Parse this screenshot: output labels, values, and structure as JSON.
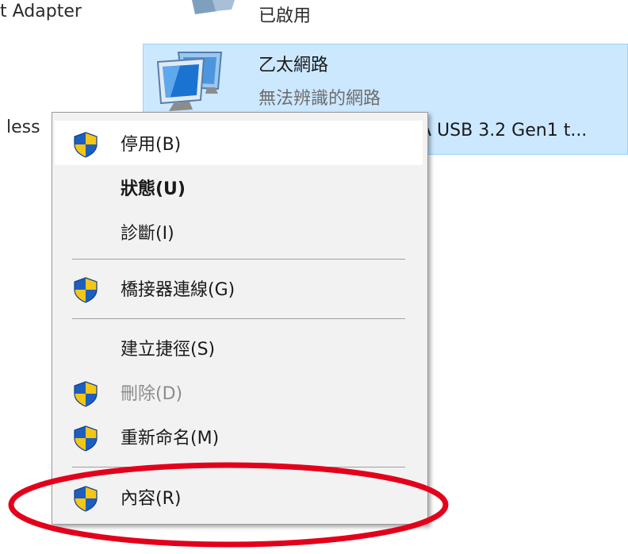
{
  "background": {
    "adapter_partial": "t Adapter",
    "disabled_status": "已啟用",
    "wireless_partial": "less"
  },
  "ethernet": {
    "name": "乙太網路",
    "status": "無法辨識的網路",
    "device": "A USB 3.2 Gen1 t..."
  },
  "context_menu": {
    "items": [
      {
        "label": "停用(B)",
        "icon": "uac-shield-icon"
      },
      {
        "label": "狀態(U)",
        "icon": ""
      },
      {
        "label": "診斷(I)",
        "icon": ""
      },
      {
        "label": "橋接器連線(G)",
        "icon": "uac-shield-icon"
      },
      {
        "label": "建立捷徑(S)",
        "icon": ""
      },
      {
        "label": "刪除(D)",
        "icon": "uac-shield-icon"
      },
      {
        "label": "重新命名(M)",
        "icon": "uac-shield-icon"
      },
      {
        "label": "內容(R)",
        "icon": "uac-shield-icon"
      }
    ]
  },
  "colors": {
    "selection_bg": "#cce8ff",
    "menu_bg": "#f2f2f2",
    "annotation_red": "#e3001b",
    "shield_blue": "#1d5fbf",
    "shield_yellow": "#f5c518"
  }
}
